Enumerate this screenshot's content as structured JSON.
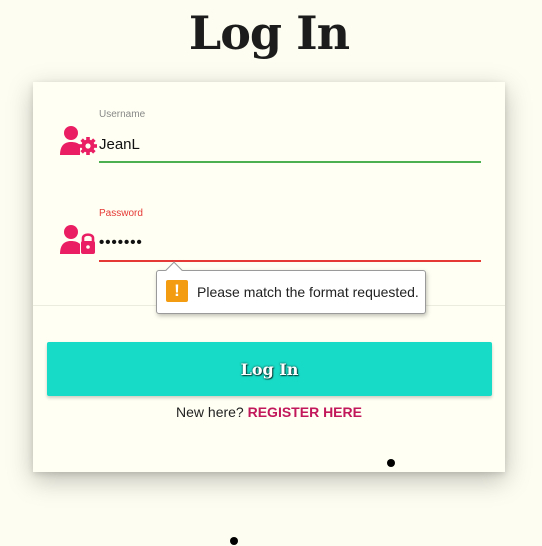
{
  "page": {
    "title": "Log In"
  },
  "form": {
    "username": {
      "label": "Username",
      "value": "JeanL",
      "icon": "user-gear-icon",
      "underline_color": "#4caf50"
    },
    "password": {
      "label": "Password",
      "value": "•••••••",
      "icon": "user-lock-icon",
      "underline_color": "#e53935",
      "label_color": "#e53935"
    },
    "validation_tooltip": {
      "message": "Please match the format requested.",
      "icon": "warning-icon",
      "icon_glyph": "!"
    },
    "submit_label": "Log In",
    "register_prompt": "New here?",
    "register_link": "REGISTER HERE"
  },
  "colors": {
    "background": "#fdfdf1",
    "card": "#fffff3",
    "accent_button": "#17dbc6",
    "icon": "#e91e63",
    "register_link": "#c2185b",
    "tooltip_warning": "#f39c12"
  }
}
